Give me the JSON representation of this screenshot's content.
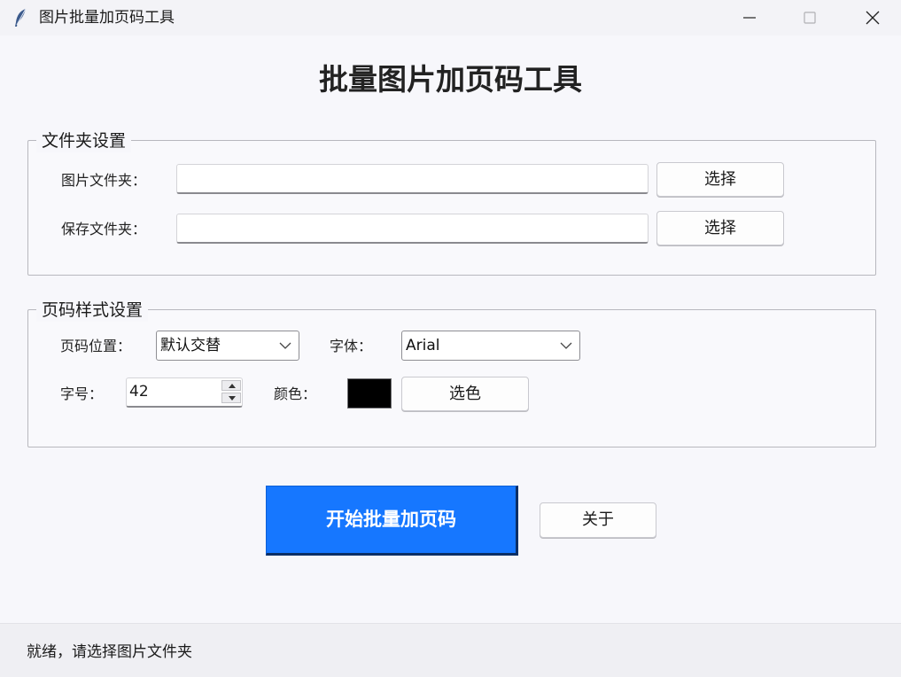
{
  "window": {
    "title": "图片批量加页码工具",
    "controls": {
      "minimize_icon": "minimize-icon",
      "maximize_icon": "maximize-icon",
      "close_icon": "close-icon"
    }
  },
  "heading": "批量图片加页码工具",
  "folder_settings": {
    "title": "文件夹设置",
    "image_folder": {
      "label": "图片文件夹：",
      "value": "",
      "button": "选择"
    },
    "save_folder": {
      "label": "保存文件夹：",
      "value": "",
      "button": "选择"
    }
  },
  "style_settings": {
    "title": "页码样式设置",
    "position": {
      "label": "页码位置：",
      "selected": "默认交替"
    },
    "font": {
      "label": "字体：",
      "selected": "Arial"
    },
    "size": {
      "label": "字号：",
      "value": "42"
    },
    "color": {
      "label": "颜色：",
      "swatch": "#000000",
      "button": "选色"
    }
  },
  "actions": {
    "start": "开始批量加页码",
    "about": "关于"
  },
  "colors": {
    "primary": "#1677ff"
  },
  "status": "就绪，请选择图片文件夹"
}
